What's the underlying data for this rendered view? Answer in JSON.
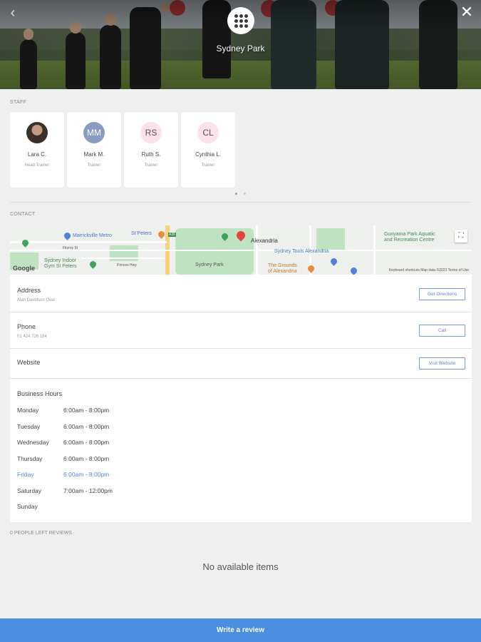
{
  "header": {
    "venue_name": "Sydney Park",
    "back_icon": "chevron-left-icon",
    "close_icon": "close-icon",
    "logo_icon": "dots-grid-logo-icon"
  },
  "staff": {
    "label": "STAFF",
    "members": [
      {
        "initials": "",
        "name": "Lara C.",
        "role": "Head Trainer"
      },
      {
        "initials": "MM",
        "name": "Mark M.",
        "role": "Trainer"
      },
      {
        "initials": "RS",
        "name": "Ruth S.",
        "role": "Trainer"
      },
      {
        "initials": "CL",
        "name": "Cynthia L.",
        "role": "Trainer"
      }
    ]
  },
  "contact": {
    "label": "CONTACT",
    "map": {
      "labels": {
        "marrickville_metro": "Marrickville Metro",
        "st_peters": "St Peters",
        "alexandria": "Alexandria",
        "sydney_tools": "Sydney Tools Alexandria",
        "sydney_park": "Sydney Park",
        "gunyama": "Gunyama Park Aquatic\nand Recreation Centre",
        "sydney_indoor": "Sydney Indoor\nGym St Peters",
        "grounds": "The Grounds\nof Alexandria",
        "fitzroy": "Fitzroy St",
        "princes": "Princes Hwy",
        "google": "Google",
        "attribution": "Keyboard shortcuts   Map data ©2023   Terms of Use",
        "road_sign": "A36"
      }
    },
    "address": {
      "title": "Address",
      "value": "Alan Davidson Oval",
      "button": "Get Directions"
    },
    "phone": {
      "title": "Phone",
      "value": "01 424 726 184",
      "button": "Call"
    },
    "website": {
      "title": "Website",
      "button": "Visit Website"
    },
    "hours": {
      "title": "Business Hours",
      "days": [
        {
          "day": "Monday",
          "time": "6:00am - 8:00pm"
        },
        {
          "day": "Tuesday",
          "time": "6:00am - 8:00pm"
        },
        {
          "day": "Wednesday",
          "time": "6:00am - 8:00pm"
        },
        {
          "day": "Thursday",
          "time": "6:00am - 8:00pm"
        },
        {
          "day": "Friday",
          "time": "6:00am - 8:00pm"
        },
        {
          "day": "Saturday",
          "time": "7:00am - 12:00pm"
        },
        {
          "day": "Sunday",
          "time": ""
        }
      ],
      "highlight_color": "#5a86d0"
    }
  },
  "reviews": {
    "label": "0 PEOPLE LEFT REVIEWS",
    "empty_text": "No available items"
  },
  "footer": {
    "write_review": "Write a review",
    "color": "#4a8fdf"
  }
}
